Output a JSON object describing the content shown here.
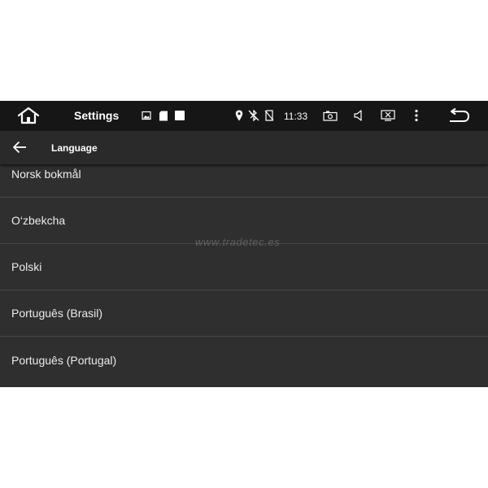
{
  "status_bar": {
    "app_title": "Settings",
    "time": "11:33",
    "icons": [
      "home-icon",
      "image-notification-icon",
      "sd-card-icon",
      "square-notification-icon",
      "location-icon",
      "bluetooth-off-icon",
      "no-sim-icon",
      "screenshot-icon",
      "volume-icon",
      "close-app-icon",
      "overflow-menu-icon",
      "return-icon"
    ]
  },
  "toolbar": {
    "title": "Language"
  },
  "languages": [
    "Norsk bokmål",
    "O‘zbekcha",
    "Polski",
    "Português (Brasil)",
    "Português (Portugal)"
  ],
  "watermark": "www.tradetec.es",
  "colors": {
    "status_bar_bg": "#161616",
    "toolbar_bg": "#2a2a2a",
    "list_bg": "#2f2f2f",
    "divider": "#474747",
    "text": "#ececec"
  }
}
